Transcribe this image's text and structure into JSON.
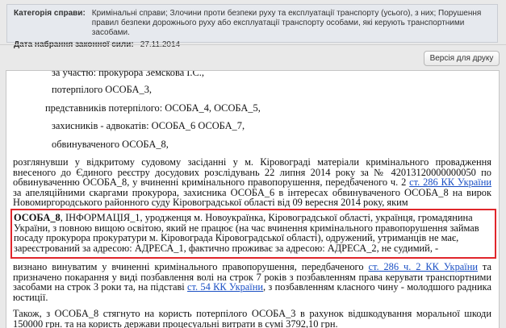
{
  "meta": {
    "category_label": "Категорія справи:",
    "category_value": "Кримінальні справи; Злочини проти безпеки руху та експлуатації транспорту (усього), з них; Порушення правил безпеки дорожнього руху або експлуатації транспорту особами, які керують транспортними засобами.",
    "date_label": "Дата набрання законної сили:",
    "date_value": "27.11.2014"
  },
  "toolbar": {
    "print_label": "Версія для друку"
  },
  "document": {
    "line_prosecutor": "за участю: прокурора Земскова І.С.,",
    "line_victim": "потерпілого ОСОБА_3,",
    "line_reps": "представників потерпілого: ОСОБА_4, ОСОБА_5,",
    "line_defenders": "захисників - адвокатів: ОСОБА_6 ОСОБА_7,",
    "line_accused": "обвинуваченого ОСОБА_8,",
    "para1_a": "розглянувши у відкритому судовому засіданні у м. Кіровограді матеріали кримінального провадження внесеного до Єдиного реєстру досудових розслідувань 22 липня 2014 року за № 42013120000000050 по обвинуваченню ОСОБА_8, у вчиненні кримінального правопорушення, передбаченого ч. 2 ",
    "para1_link": "ст. 286 КК України",
    "para1_b": " за апеляційними скаргами прокурора, захисника ОСОБА_6 в інтересах обвинуваченого ОСОБА_8 на вирок Новомиргородського районного суду Кіровоградської області від 09 вересня 2014 року, яким",
    "para2_name": "ОСОБА_8",
    "para2_text": ", ІНФОРМАЦІЯ_1, уродженця м. Новоукраїнка, Кіровоградської області, українця, громадянина України, з повною вищою освітою, який не працює (на час вчинення кримінального правопорушення займав посаду прокурора прокуратури м. Кіровограда Кіровоградської області), одружений, утриманців не має, зареєстрований за адресою: АДРЕСА_1, фактично проживає за адресою: АДРЕСА_2, не судимий, -",
    "para3_a": "визнано винуватим у вчиненні кримінального правопорушення, передбаченого ",
    "para3_link1": "ст. 286 ч. 2 КК України",
    "para3_b": " та призначено покарання у виді позбавлення волі на строк 7 років з позбавленням права керувати транспортними засобами на строк 3 роки та, на підставі ",
    "para3_link2": "ст. 54 КК України",
    "para3_c": ", з позбавленням класного чину - молодшого радника юстиції.",
    "para4": "Також, з ОСОБА_8 стягнуто на користь потерпілого ОСОБА_3 в рахунок відшкодування моральної шкоди 150000 грн. та на користь держави процесуальні витрати в сумі 3792,10 грн."
  }
}
